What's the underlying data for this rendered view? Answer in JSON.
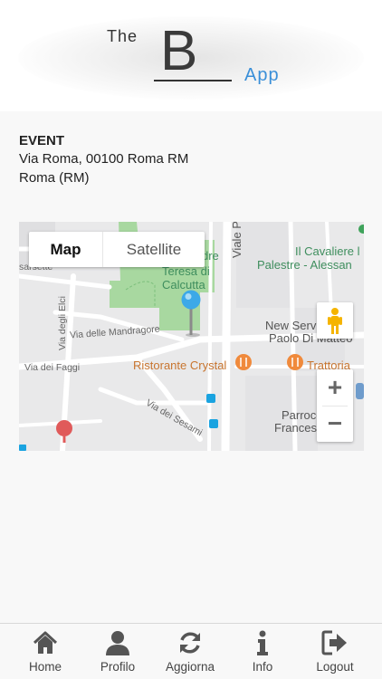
{
  "header": {
    "logo_the": "The",
    "logo_b": "B",
    "logo_app": "App"
  },
  "event": {
    "title": "EVENT",
    "address": "Via Roma, 00100 Roma RM",
    "city": "Roma (RM)"
  },
  "map": {
    "type_buttons": [
      "Map",
      "Satellite"
    ],
    "selected_type": "Map",
    "zoom_in": "+",
    "zoom_out": "−",
    "labels": {
      "dre": "dre",
      "teresa": "Teresa di",
      "calcutta": "Calcutta",
      "viale_palmi": "Viale Palmi",
      "cavaliere": "Il Cavaliere l",
      "palestre": "Palestre - Alessan",
      "sarsette": "sarsette",
      "new_serv": "New Serv",
      "paolo": "Paolo Di Matteo",
      "mandragore": "Via delle Mandragore",
      "degli_elci": "Via degli Elci",
      "faggi": "Via dei Faggi",
      "ristorante": "Ristorante Crystal",
      "trattoria": "Trattoria",
      "sesami": "Via dei Sesami",
      "parrocchia": "Parrocchia",
      "francesco": "Francesco"
    }
  },
  "tabbar": {
    "items": [
      {
        "label": "Home",
        "icon": "home-icon"
      },
      {
        "label": "Profilo",
        "icon": "user-icon"
      },
      {
        "label": "Aggiorna",
        "icon": "refresh-icon"
      },
      {
        "label": "Info",
        "icon": "info-icon"
      },
      {
        "label": "Logout",
        "icon": "logout-icon"
      }
    ]
  },
  "colors": {
    "accent_blue": "#3a8fd8",
    "park_green": "#a8d8a0",
    "map_background": "#e9e9ea",
    "poi_orange": "#f08a3c"
  }
}
